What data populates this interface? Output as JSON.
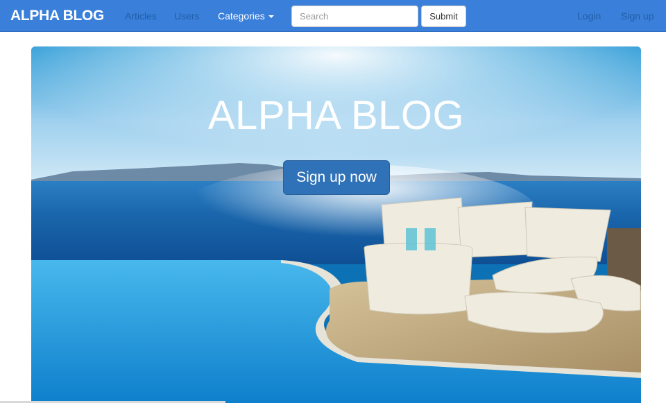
{
  "navbar": {
    "brand": "ALPHA BLOG",
    "links": {
      "articles": "Articles",
      "users": "Users",
      "categories": "Categories",
      "login": "Login",
      "signup": "Sign up"
    },
    "search": {
      "placeholder": "Search",
      "value": ""
    },
    "submit_label": "Submit"
  },
  "hero": {
    "title": "ALPHA BLOG",
    "cta_label": "Sign up now"
  },
  "icons": {
    "categories_caret": "caret-down-icon"
  },
  "colors": {
    "navbar_bg": "#3a7fd9",
    "cta_bg": "#2f72b8",
    "muted_link": "#1f5fa8"
  }
}
